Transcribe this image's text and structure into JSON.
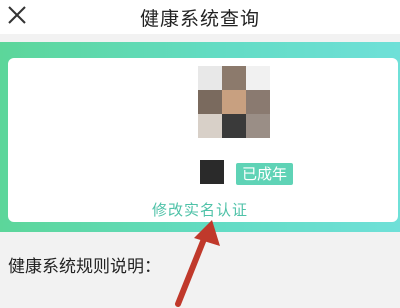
{
  "header": {
    "close_icon": "close-icon",
    "title": "健康系统查询"
  },
  "profile": {
    "age_status": "已成年",
    "modify_link": "修改实名认证"
  },
  "rules": {
    "label": "健康系统规则说明："
  },
  "colors": {
    "banner_start": "#5cd69a",
    "banner_end": "#6fe0d8",
    "accent": "#4fc2a8",
    "annotation_arrow": "#c0392b"
  }
}
